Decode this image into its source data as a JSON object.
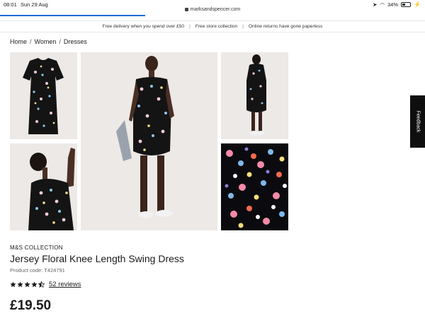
{
  "status": {
    "time": "08:01",
    "date": "Sun 29 Aug",
    "url": "marksandspencer.com",
    "battery": "34%"
  },
  "banner": {
    "items": [
      "Free delivery when you spend over £50",
      "Free store collection",
      "Online returns have gone paperless"
    ]
  },
  "breadcrumb": [
    "Home",
    "Women",
    "Dresses"
  ],
  "feedback": {
    "label": "Feedback"
  },
  "product": {
    "brand": "M&S COLLECTION",
    "title": "Jersey Floral Knee Length Swing Dress",
    "code": "Product code: T424791",
    "rating": 4.5,
    "reviews": "52 reviews",
    "price": "£19.50"
  },
  "colors": {
    "accent": "#1e6bd6",
    "text": "#1a1a1a",
    "image_bg": "#ede9e6",
    "print_bg": "#0b0b0f"
  }
}
